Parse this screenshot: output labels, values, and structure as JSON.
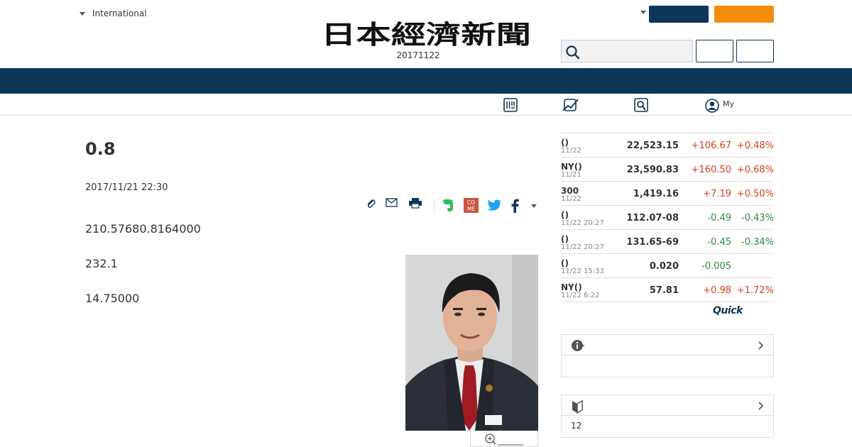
{
  "header": {
    "edition_label": "International",
    "masthead": "日本經濟新聞",
    "date": "20171122",
    "search_placeholder": ""
  },
  "subnav": {
    "my_label": "My"
  },
  "article": {
    "title": "0.8",
    "date": "2017/11/21 22:30",
    "paragraphs": [
      "210.57680.8164000",
      "232.1",
      "14.75000"
    ]
  },
  "market": {
    "rows": [
      {
        "name": "()",
        "time": "11/22",
        "value": "22,523.15",
        "change": "+106.67",
        "pct": "+0.48%",
        "dir": "up"
      },
      {
        "name": "NY()",
        "time": "11/21",
        "value": "23,590.83",
        "change": "+160.50",
        "pct": "+0.68%",
        "dir": "up"
      },
      {
        "name": "300",
        "time": "11/22",
        "value": "1,419.16",
        "change": "+7.19",
        "pct": "+0.50%",
        "dir": "up"
      },
      {
        "name": "()",
        "time": "11/22 20:27",
        "value": "112.07-08",
        "change": "-0.49",
        "pct": "-0.43%",
        "dir": "down"
      },
      {
        "name": "()",
        "time": "11/22 20:27",
        "value": "131.65-69",
        "change": "-0.45",
        "pct": "-0.34%",
        "dir": "down"
      },
      {
        "name": "()",
        "time": "11/22 15:33",
        "value": "0.020",
        "change": "-0.005",
        "pct": "",
        "dir": "down"
      },
      {
        "name": "NY()",
        "time": "11/22 6:22",
        "value": "57.81",
        "change": "+0.98",
        "pct": "+1.72%",
        "dir": "up"
      }
    ],
    "quick_logo": "Quick"
  },
  "sidebox2": {
    "body_text": "12"
  },
  "colors": {
    "navy": "#0e3658",
    "orange": "#f78c0a",
    "up": "#d4401b",
    "down": "#2a8c3b"
  }
}
